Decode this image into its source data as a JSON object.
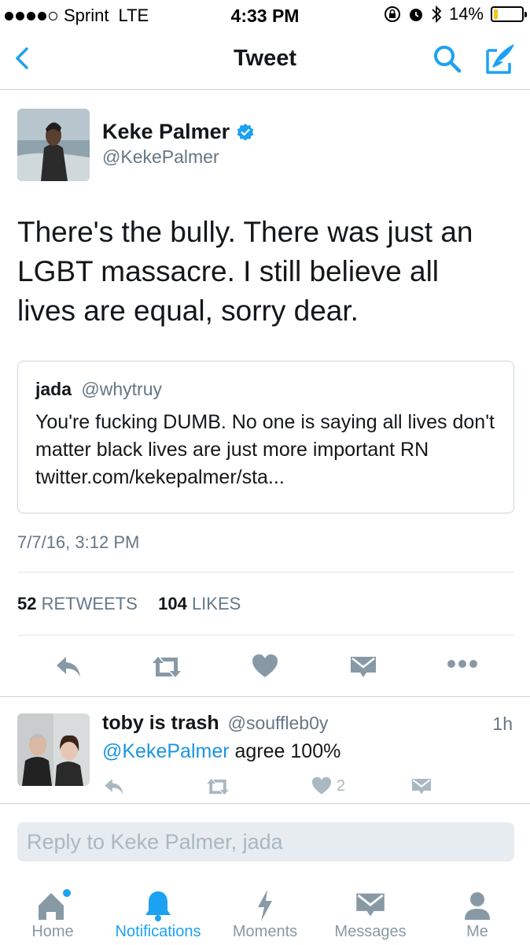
{
  "status_bar": {
    "carrier": "Sprint",
    "network": "LTE",
    "time": "4:33 PM",
    "battery_text": "14%",
    "battery_level": 0.14
  },
  "nav": {
    "title": "Tweet"
  },
  "tweet": {
    "author_name": "Keke Palmer",
    "author_handle": "@KekePalmer",
    "text": "There's the bully. There was just an LGBT massacre. I still believe all lives are equal, sorry dear.",
    "quoted": {
      "name": "jada",
      "handle": "@whytruy",
      "text": "You're fucking DUMB. No one is saying all lives don't matter black lives are just more important RN  twitter.com/kekepalmer/sta..."
    },
    "timestamp": "7/7/16, 3:12 PM",
    "retweet_count": "52",
    "retweet_label": "RETWEETS",
    "like_count": "104",
    "like_label": "LIKES"
  },
  "reply": {
    "name": "toby is trash",
    "handle": "@souffleb0y",
    "time": "1h",
    "mention": "@KekePalmer",
    "text": " agree 100%",
    "like_count": "2"
  },
  "reply_box": {
    "placeholder": "Reply to Keke Palmer, jada"
  },
  "tabs": [
    {
      "label": "Home",
      "icon": "home-icon"
    },
    {
      "label": "Notifications",
      "icon": "bell-icon"
    },
    {
      "label": "Moments",
      "icon": "lightning-icon"
    },
    {
      "label": "Messages",
      "icon": "envelope-icon"
    },
    {
      "label": "Me",
      "icon": "person-icon"
    }
  ],
  "colors": {
    "accent": "#1da1f2",
    "mention": "#1b95e0",
    "muted": "#657786",
    "action_gray": "#8899a6"
  }
}
